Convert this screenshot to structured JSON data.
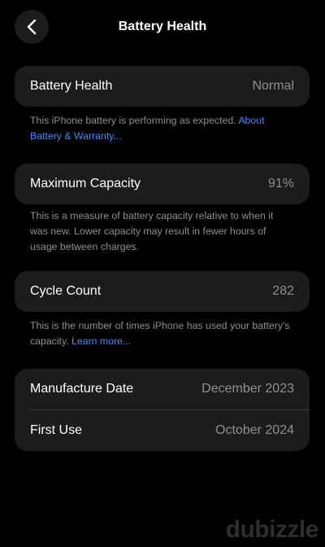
{
  "nav": {
    "title": "Battery Health",
    "back_icon": "chevron-left-icon"
  },
  "battery_health": {
    "label": "Battery Health",
    "value": "Normal",
    "note_text": "This iPhone battery is performing as expected.",
    "note_link": "About Battery & Warranty..."
  },
  "max_capacity": {
    "label": "Maximum Capacity",
    "value": "91%",
    "note_text": "This is a measure of battery capacity relative to when it was new. Lower capacity may result in fewer hours of usage between charges."
  },
  "cycle_count": {
    "label": "Cycle Count",
    "value": "282",
    "note_text": "This is the number of times iPhone has used your battery's capacity.",
    "note_link": "Learn more..."
  },
  "dates": {
    "manufacture_label": "Manufacture Date",
    "manufacture_value": "December 2023",
    "first_use_label": "First Use",
    "first_use_value": "October 2024"
  },
  "watermark": "dubizzle",
  "colors": {
    "background": "#000000",
    "card": "#1c1c1e",
    "secondary_text": "#8e8e93",
    "link": "#3a8dff"
  }
}
